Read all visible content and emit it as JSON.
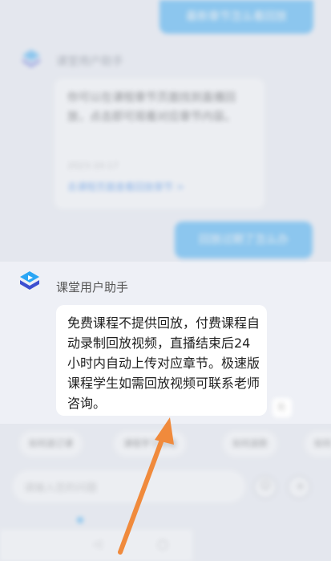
{
  "chat": {
    "user_msg_1": "最新章节怎么看回放",
    "bot_name": "课堂用户助手",
    "bot_msg_1": {
      "text": "你可以在课程章节页面找到直播回放，点击即可观看对应章节内容。",
      "meta": "2023-10-17",
      "link": "去课程页面查看回放章节 >"
    },
    "user_msg_2": "回放过期了怎么办",
    "bot_msg_2": {
      "text": "免费课程不提供回放，付费课程自动录制回放视频，直播结束后24小时内自动上传对应章节。极速版课程学生如需回放视频可联系老师咨询。"
    },
    "copy_icon": "copy-icon"
  },
  "quick_chips": [
    "如何退订课",
    "课程学习攻略",
    "如何退款",
    "如何"
  ],
  "input": {
    "placeholder": "请输入您的问题"
  },
  "colors": {
    "accent": "#2aa6f5",
    "arrow": "#f08a3c"
  }
}
